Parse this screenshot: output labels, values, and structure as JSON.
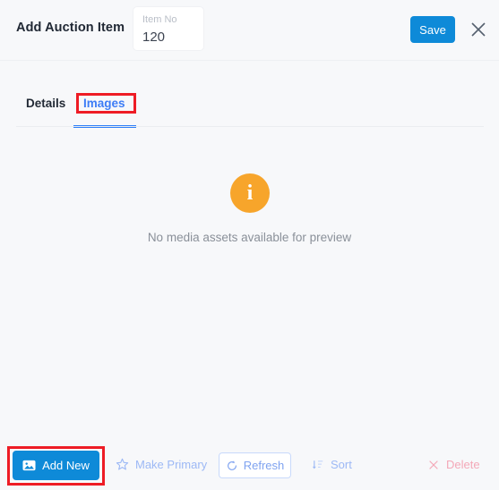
{
  "header": {
    "title": "Add Auction Item",
    "item_no": {
      "label": "Item No",
      "value": "120"
    },
    "save_label": "Save",
    "close_icon": "close-icon"
  },
  "tabs": {
    "items": [
      {
        "label": "Details",
        "active": false
      },
      {
        "label": "Images",
        "active": true
      }
    ]
  },
  "main": {
    "empty_state": {
      "icon": "info-icon",
      "icon_glyph": "i",
      "message": "No media assets available for preview"
    }
  },
  "footer": {
    "buttons": [
      {
        "label": "Add New",
        "icon": "image-icon",
        "style": "primary"
      },
      {
        "label": "Make Primary",
        "icon": "star-icon",
        "style": "disabled-link"
      },
      {
        "label": "Refresh",
        "icon": "refresh-icon",
        "style": "outlined"
      },
      {
        "label": "Sort",
        "icon": "sort-icon",
        "style": "disabled-link"
      },
      {
        "label": "Delete",
        "icon": "close-icon",
        "style": "danger-link"
      }
    ]
  },
  "annotations": [
    {
      "target": "Images",
      "color": "#ee1c25"
    },
    {
      "target": "Add New",
      "color": "#ee1c25"
    }
  ],
  "colors": {
    "primary_blue": "#0e8ad8",
    "tab_active_blue": "#2d7ff9",
    "info_orange": "#f7a52b",
    "danger_pink": "#f4a8b8",
    "background": "#f7f8fa",
    "annotation_red": "#ee1c25"
  }
}
